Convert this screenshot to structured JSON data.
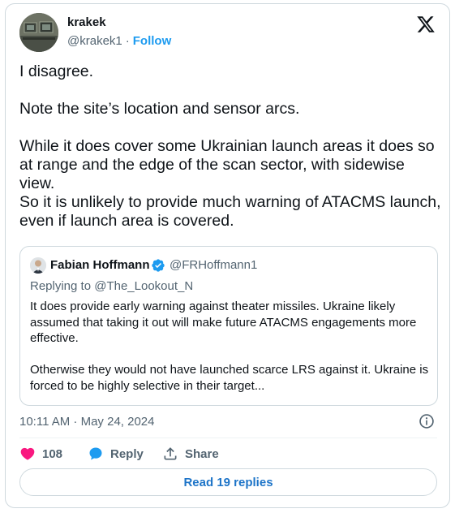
{
  "author": {
    "name": "krakek",
    "handle": "@krakek1",
    "separator": "·",
    "follow_label": "Follow"
  },
  "tweet": {
    "paragraphs": [
      "I disagree.",
      "Note the site’s location and sensor arcs.",
      "While it does cover some Ukrainian launch areas it does so at range and the edge of the scan sector, with sidewise view.",
      "So it is unlikely to provide much warning of ATACMS launch, even if launch area is covered."
    ]
  },
  "quote": {
    "name": "Fabian Hoffmann",
    "handle": "@FRHoffmann1",
    "replying_to": "Replying to @The_Lookout_N",
    "paragraphs": [
      "It does provide early warning against theater missiles. Ukraine likely assumed that taking it out will make future ATACMS engagements more effective.",
      "Otherwise they would not have launched scarce LRS against it. Ukraine is forced to be highly selective in their target..."
    ]
  },
  "meta": {
    "timestamp": "10:11 AM · May 24, 2024"
  },
  "actions": {
    "like_count": "108",
    "reply_label": "Reply",
    "share_label": "Share"
  },
  "read_replies_label": "Read 19 replies",
  "colors": {
    "like": "#f91880",
    "reply": "#1d9bf0",
    "link": "#1d9bf0",
    "verified": "#1d9bf0"
  }
}
